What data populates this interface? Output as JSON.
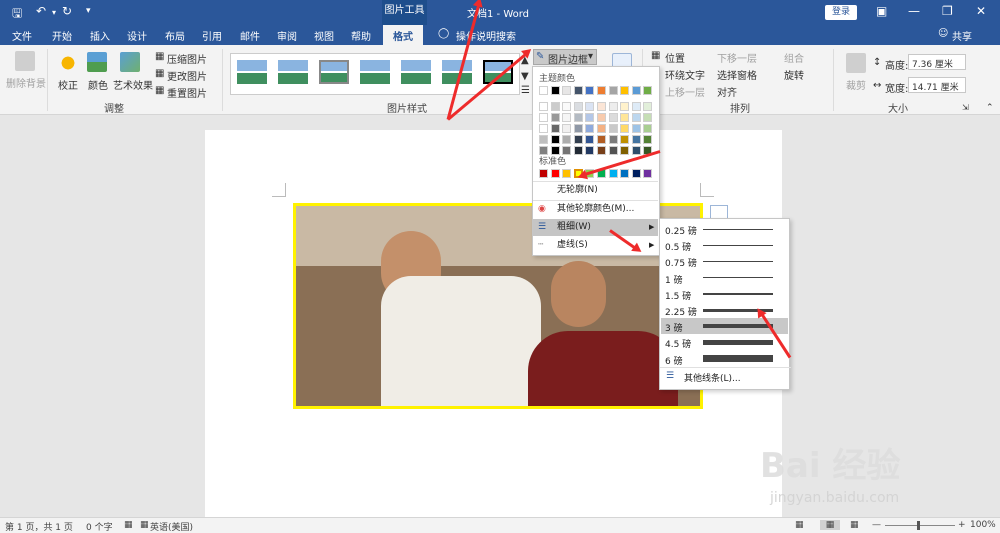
{
  "titlebar": {
    "context_group": "图片工具",
    "doc_title": "文档1 - Word",
    "login": "登录"
  },
  "tabs": [
    "文件",
    "开始",
    "插入",
    "设计",
    "布局",
    "引用",
    "邮件",
    "审阅",
    "视图",
    "帮助"
  ],
  "active_tab": "格式",
  "tell_me": "操作说明搜索",
  "share": "共享",
  "ribbon": {
    "remove_bg": "删除背景",
    "correct": "校正",
    "color": "颜色",
    "art": "艺术效果",
    "compress": "压缩图片",
    "change": "更改图片",
    "reset": "重置图片",
    "adjust_group": "调整",
    "styles_group": "图片样式",
    "border_button": "图片边框",
    "position": "位置",
    "wrap_text": "环绕文字",
    "forward": "上移一层",
    "backward": "下移一层",
    "select_pane": "选择窗格",
    "align": "对齐",
    "group": "组合",
    "rotate": "旋转",
    "arrange_group": "排列",
    "crop": "裁剪",
    "height_label": "高度:",
    "height_val": "7.36 厘米",
    "width_label": "宽度:",
    "width_val": "14.71 厘米",
    "size_group": "大小"
  },
  "border_menu": {
    "theme_colors": "主题颜色",
    "standard_colors": "标准色",
    "no_outline": "无轮廓(N)",
    "more_colors": "其他轮廓颜色(M)...",
    "weight": "粗细(W)",
    "dashes": "虚线(S)",
    "theme_top": [
      "#ffffff",
      "#000000",
      "#e7e6e6",
      "#44546a",
      "#4472c4",
      "#ed7d31",
      "#a5a5a5",
      "#ffc000",
      "#5b9bd5",
      "#70ad47"
    ],
    "standard": [
      "#c00000",
      "#ff0000",
      "#ffc000",
      "#ffff00",
      "#92d050",
      "#00b050",
      "#00b0f0",
      "#0070c0",
      "#002060",
      "#7030a0"
    ],
    "selected_color": "#ffff00"
  },
  "weight_menu": {
    "items": [
      {
        "label": "0.25 磅",
        "w": 0.25
      },
      {
        "label": "0.5 磅",
        "w": 0.5
      },
      {
        "label": "0.75 磅",
        "w": 0.75
      },
      {
        "label": "1 磅",
        "w": 1
      },
      {
        "label": "1.5 磅",
        "w": 1.5
      },
      {
        "label": "2.25 磅",
        "w": 2.25
      },
      {
        "label": "3 磅",
        "w": 3
      },
      {
        "label": "4.5 磅",
        "w": 4.5
      },
      {
        "label": "6 磅",
        "w": 6
      }
    ],
    "more": "其他线条(L)...",
    "selected": "3 磅"
  },
  "statusbar": {
    "page": "第 1 页，共 1 页",
    "words": "0 个字",
    "lang": "英语(美国)",
    "zoom": "100%"
  },
  "watermark": {
    "brand": "Bai 经验",
    "url": "jingyan.baidu.com"
  }
}
